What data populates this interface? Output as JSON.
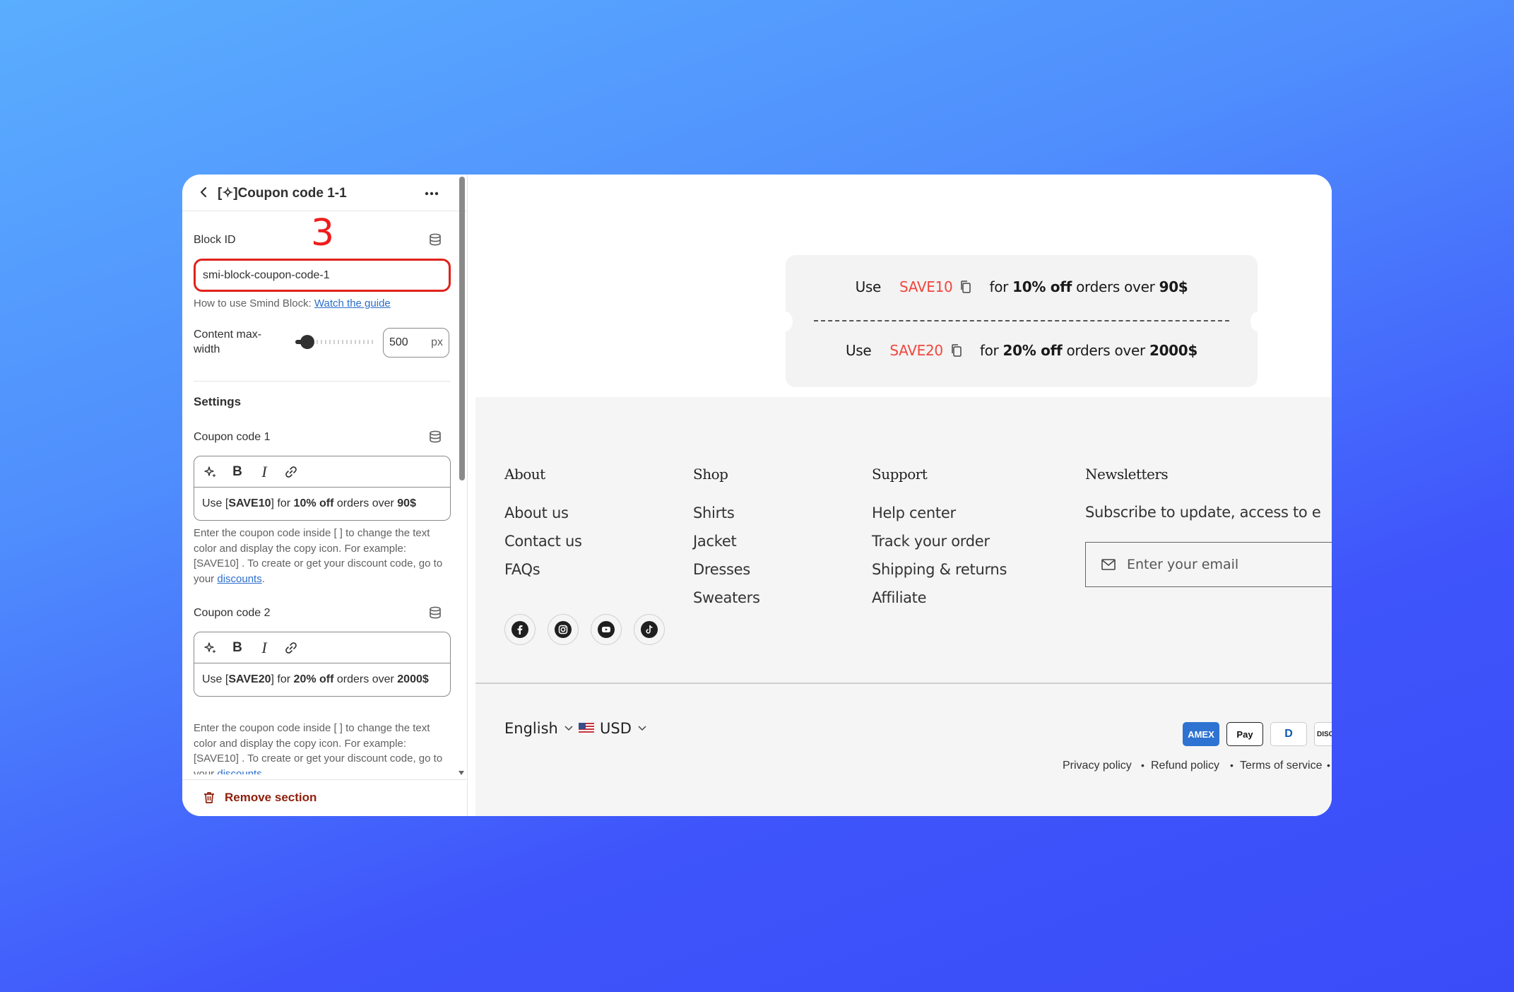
{
  "editor": {
    "title": "[✧]Coupon code 1-1",
    "step_annotation": "3",
    "block_id_label": "Block ID",
    "block_id_value": "smi-block-coupon-code-1",
    "howto_text": "How to use Smind Block:",
    "howto_link": "Watch the guide",
    "max_width_label": "Content max-width",
    "max_width_value": "500",
    "max_width_unit": "px",
    "max_width_level": 0.15,
    "settings_title": "Settings",
    "coupon1": {
      "label": "Coupon code 1",
      "text_pre": "Use [",
      "code": "SAVE10",
      "text_mid": "] for ",
      "discount": "10% off",
      "text_post": " orders over ",
      "amount": "90$"
    },
    "coupon2": {
      "label": "Coupon code 2",
      "text_pre": "Use [",
      "code": "SAVE20",
      "text_mid": "] for ",
      "discount": "20% off",
      "text_post": " orders over ",
      "amount": "2000$"
    },
    "help_line1": "Enter the coupon code inside [ ] to change the text color and display the copy icon. For example: [SAVE10] . To create or get your discount code, go to your ",
    "help_link": "discounts",
    "help_end": ".",
    "remove_label": "Remove section"
  },
  "preview": {
    "coupons": [
      {
        "use": "Use",
        "code": "SAVE10",
        "for": "for",
        "discount": "10% off",
        "orders": "orders over",
        "amount": "90$"
      },
      {
        "use": "Use",
        "code": "SAVE20",
        "for": "for",
        "discount": "20% off",
        "orders": "orders over",
        "amount": "2000$"
      }
    ],
    "footer": {
      "about_title": "About",
      "about_links": [
        "About us",
        "Contact us",
        "FAQs"
      ],
      "shop_title": "Shop",
      "shop_links": [
        "Shirts",
        "Jacket",
        "Dresses",
        "Sweaters"
      ],
      "support_title": "Support",
      "support_links": [
        "Help center",
        "Track your order",
        "Shipping & returns",
        "Affiliate"
      ],
      "newsletter_title": "Newsletters",
      "newsletter_text": "Subscribe to update, access to e",
      "email_placeholder": "Enter your email",
      "language": "English",
      "currency": "USD",
      "payments": [
        "AMEX",
        "Pay",
        "D",
        "DISC"
      ],
      "policies": [
        "Privacy policy",
        "Refund policy",
        "Terms of service"
      ],
      "bullet": "•"
    }
  },
  "colors": {
    "coupon_code": "#f0473d",
    "annotation": "#ee1c1c",
    "focus_border": "#e0221b",
    "link": "#2c6ecb",
    "remove": "#8e1f0b"
  }
}
